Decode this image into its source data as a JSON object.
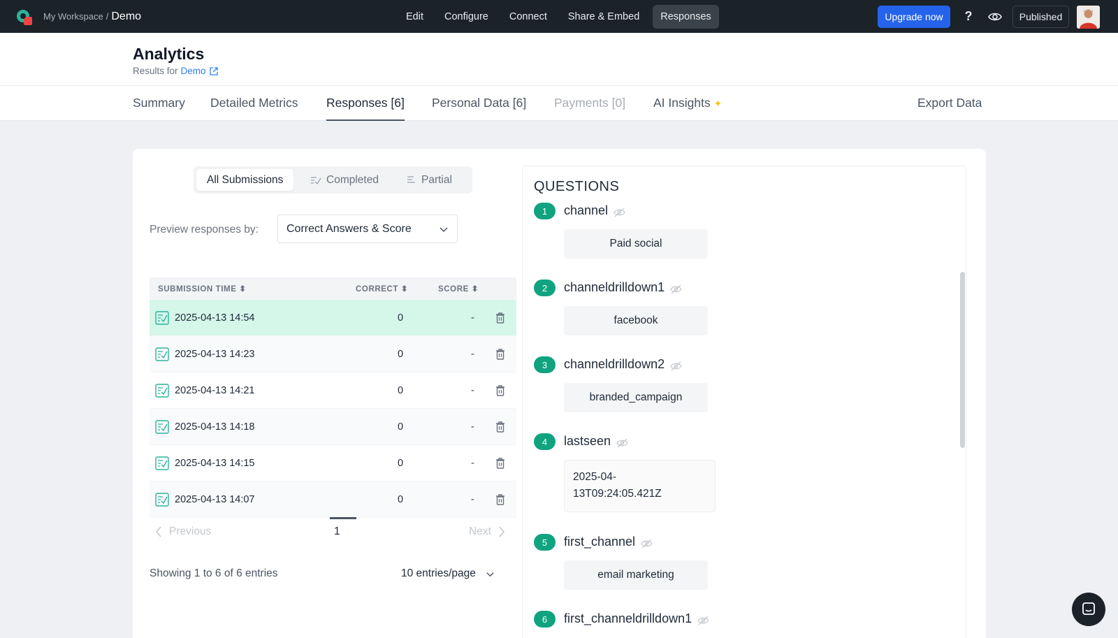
{
  "topbar": {
    "workspace": "My Workspace",
    "separator": "/",
    "current": "Demo",
    "nav": [
      "Edit",
      "Configure",
      "Connect",
      "Share & Embed",
      "Responses"
    ],
    "active_nav": "Responses",
    "upgrade_label": "Upgrade now",
    "help_label": "?",
    "published_label": "Published",
    "accent_color": "#2563eb"
  },
  "header": {
    "title": "Analytics",
    "subtitle_prefix": "Results for",
    "subtitle_link": "Demo"
  },
  "tabs": {
    "summary": "Summary",
    "detailed": "Detailed Metrics",
    "responses": "Responses [6]",
    "personal": "Personal Data [6]",
    "payments": "Payments [0]",
    "ai": "AI Insights",
    "export": "Export Data"
  },
  "filters": {
    "all": "All Submissions",
    "completed": "Completed",
    "partial": "Partial"
  },
  "preview": {
    "label": "Preview responses by:",
    "value": "Correct Answers & Score"
  },
  "table": {
    "columns": [
      "SUBMISSION TIME",
      "CORRECT",
      "SCORE"
    ],
    "rows": [
      {
        "time": "2025-04-13 14:54",
        "correct": "0",
        "score": "-"
      },
      {
        "time": "2025-04-13 14:23",
        "correct": "0",
        "score": "-"
      },
      {
        "time": "2025-04-13 14:21",
        "correct": "0",
        "score": "-"
      },
      {
        "time": "2025-04-13 14:18",
        "correct": "0",
        "score": "-"
      },
      {
        "time": "2025-04-13 14:15",
        "correct": "0",
        "score": "-"
      },
      {
        "time": "2025-04-13 14:07",
        "correct": "0",
        "score": "-"
      }
    ],
    "selected_row_color": "#d4f7ea"
  },
  "pager": {
    "previous": "Previous",
    "page": "1",
    "next": "Next"
  },
  "footer": {
    "showing": "Showing 1 to 6 of 6 entries",
    "per_page": "10 entries/page"
  },
  "questions": {
    "title": "QUESTIONS",
    "items": [
      {
        "num": "1",
        "label": "channel",
        "answer": "Paid social"
      },
      {
        "num": "2",
        "label": "channeldrilldown1",
        "answer": "facebook"
      },
      {
        "num": "3",
        "label": "channeldrilldown2",
        "answer": "branded_campaign"
      },
      {
        "num": "4",
        "label": "lastseen",
        "answer": "2025-04-\n13T09:24:05.421Z"
      },
      {
        "num": "5",
        "label": "first_channel",
        "answer": "email marketing"
      },
      {
        "num": "6",
        "label": "first_channeldrilldown1",
        "answer": ""
      }
    ],
    "badge_color": "#10a37f"
  }
}
